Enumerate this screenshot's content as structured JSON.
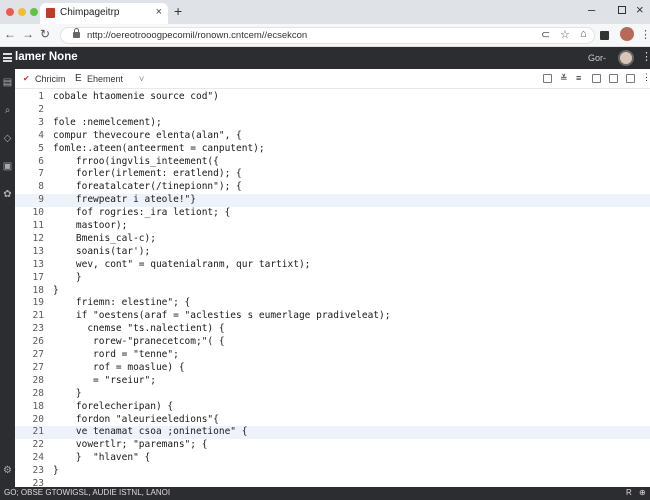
{
  "browser": {
    "tab_title": "Chimpageitrp",
    "url": "nttp://oereotrooogpecomil/ronown.cntcem//ecsekcon"
  },
  "app": {
    "title": "lamer None",
    "user_label": "Gor-"
  },
  "toolbar": {
    "crumb1": "Chricim",
    "crumb2": "E",
    "crumb3": "Ehement"
  },
  "editor": {
    "lines": [
      {
        "n": "1",
        "code": "cobale htaomenie source cod\")"
      },
      {
        "n": "2",
        "code": ""
      },
      {
        "n": "3",
        "code": "fole :nemelcement);"
      },
      {
        "n": "4",
        "code": "compur thevecoure elenta(alan\", {"
      },
      {
        "n": "5",
        "code": "fomle:.ateen(anteerment = canputent);"
      },
      {
        "n": "6",
        "code": "    frroo(ingvlis_inteement({"
      },
      {
        "n": "7",
        "code": "    forler(irlement: eratlend); {"
      },
      {
        "n": "8",
        "code": "    foreatalcater(/tinepionn\"); {"
      },
      {
        "n": "9",
        "code": "    frewpeatr i ateole!\"}"
      },
      {
        "n": "10",
        "code": "    fof rogries:_ira letiont; {"
      },
      {
        "n": "11",
        "code": "    mastoor);"
      },
      {
        "n": "12",
        "code": "    Bmenis_cal-c);"
      },
      {
        "n": "13",
        "code": "    soanis(tar');"
      },
      {
        "n": "13",
        "code": "    wev, cont\" = quatenialranm, qur tartixt);"
      },
      {
        "n": "17",
        "code": "    }"
      },
      {
        "n": "18",
        "code": "}"
      },
      {
        "n": "19",
        "code": "    friemn: elestine\"; {"
      },
      {
        "n": "21",
        "code": "    if \"oestens(araf = \"aclesties s eumerlage pradiveleat);"
      },
      {
        "n": "23",
        "code": "      cnemse \"ts.nalectient) {"
      },
      {
        "n": "26",
        "code": "       rorew-\"pranecetcom;\"( {"
      },
      {
        "n": "27",
        "code": "       rord = \"tenne\";"
      },
      {
        "n": "27",
        "code": "       rof = moaslue) {"
      },
      {
        "n": "28",
        "code": "       = \"rseiur\";"
      },
      {
        "n": "28",
        "code": "    }"
      },
      {
        "n": "18",
        "code": "    forelecheripan) {"
      },
      {
        "n": "20",
        "code": "    fordon \"aleurieeledions\"{"
      },
      {
        "n": "21",
        "code": "    ve tenamat csoa ;oninetione\" {"
      },
      {
        "n": "22",
        "code": "    vowertlr; \"paremans\"; {"
      },
      {
        "n": "24",
        "code": "    }  \"hlaven\" {"
      },
      {
        "n": "23",
        "code": "}"
      },
      {
        "n": "23",
        "code": ""
      }
    ]
  },
  "status": {
    "text": "GO; OBSE    GTOWIGSL, AUDIE ISTNL, LANOI",
    "right_1": "R",
    "right_2": "⊕"
  }
}
